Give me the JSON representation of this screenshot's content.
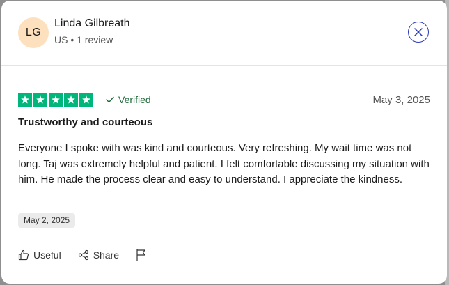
{
  "reviewer": {
    "initials": "LG",
    "name": "Linda Gilbreath",
    "meta": "US • 1 review"
  },
  "review": {
    "rating": 5,
    "verified_label": "Verified",
    "date": "May 3, 2025",
    "title": "Trustworthy and courteous",
    "body": "Everyone I spoke with was kind and courteous. Very refreshing. My wait time was not long. Taj was extremely helpful and patient. I felt comfortable discussing my situation with him. He made the process clear and easy to understand. I appreciate the kindness.",
    "experience_date": "May 2, 2025"
  },
  "actions": {
    "useful_label": "Useful",
    "share_label": "Share"
  },
  "colors": {
    "star_green": "#00b67a",
    "verified_green": "#1f6a3a",
    "close_blue": "#2a3bb7",
    "avatar_bg": "#fde0bd"
  },
  "icons": {
    "close": "close-icon",
    "star": "star-icon",
    "check": "check-icon",
    "useful": "thumbs-up-icon",
    "share": "share-icon",
    "flag": "flag-icon"
  }
}
